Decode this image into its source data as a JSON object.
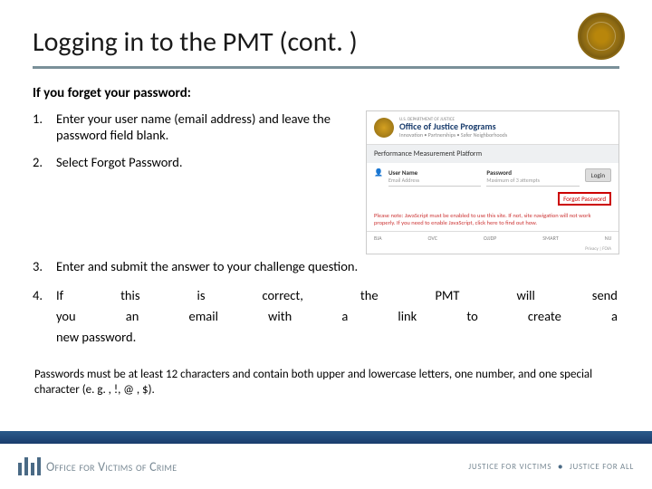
{
  "header": {
    "title": "Logging in to the PMT (cont. )"
  },
  "intro": "If you forget your password:",
  "steps": {
    "s1": "Enter your user name (email address) and leave the password field blank.",
    "s2": "Select Forgot Password.",
    "s3": "Enter and submit the answer to your challenge question.",
    "s4r1": {
      "a": "If",
      "b": "this",
      "c": "is",
      "d": "correct,",
      "e": "the",
      "f": "PMT",
      "g": "will",
      "h": "send"
    },
    "s4r2": {
      "a": "you",
      "b": "an",
      "c": "email",
      "d": "with",
      "e": "a",
      "f": "link",
      "g": "to",
      "h": "create",
      "i": "a"
    },
    "s4r3": "new password."
  },
  "password_note": "Passwords must be at least 12 characters and contain both upper and lowercase letters, one number, and one special character (e. g. , !, @ , $).",
  "screenshot": {
    "dept": "U.S. DEPARTMENT OF JUSTICE",
    "ojp": "Office of Justice Programs",
    "tagline": "Innovation • Partnerships • Safer Neighborhoods",
    "platform": "Performance Measurement Platform",
    "user_icon": "👤",
    "user_label": "User Name",
    "user_hint": "Email Address",
    "pass_label": "Password",
    "pass_hint": "Maximum of 3 attempts",
    "login": "Login",
    "forgot": "Forgot Password",
    "note": "Please note: JavaScript must be enabled to use this site. If not, site navigation will not work properly. If you need to enable JavaScript, click here to find out how.",
    "logos": {
      "a": "BJA",
      "b": "OVC",
      "c": "OJJDP",
      "d": "SMART",
      "e": "NIJ"
    },
    "foia": "Privacy | FOIA"
  },
  "footer": {
    "ovc": "Office for Victims of Crime",
    "right_a": "JUSTICE FOR VICTIMS",
    "right_b": "JUSTICE FOR ALL"
  }
}
